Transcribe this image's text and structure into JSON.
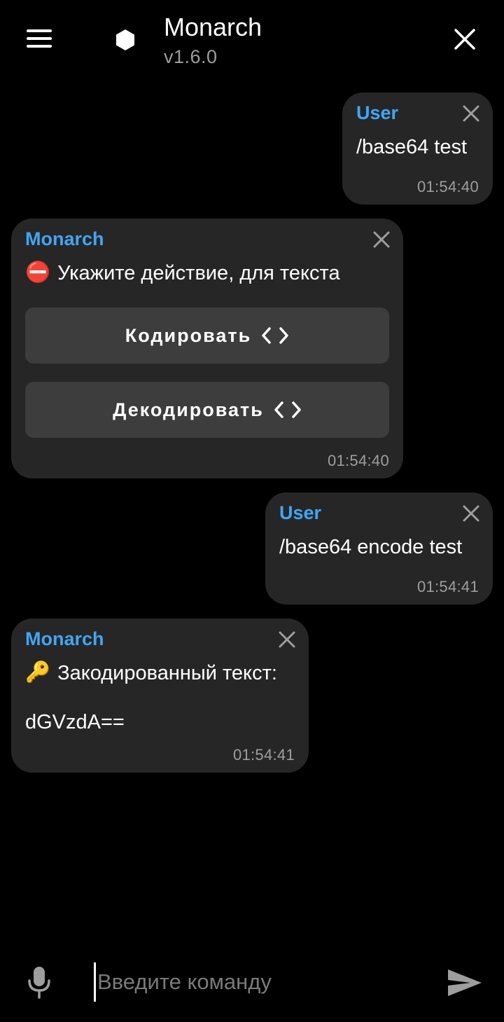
{
  "header": {
    "title": "Monarch",
    "version": "v1.6.0",
    "menu_icon": "hamburger-menu-icon",
    "logo_icon": "hexagon-icon",
    "close_icon": "close-icon"
  },
  "messages": [
    {
      "sender": "User",
      "text": "/base64 test",
      "time": "01:54:40"
    },
    {
      "sender": "Monarch",
      "emoji": "⛔",
      "text": "Укажите действие, для текста",
      "buttons": [
        {
          "label": "Кодировать",
          "icon": "code-icon"
        },
        {
          "label": "Декодировать",
          "icon": "code-icon"
        }
      ],
      "time": "01:54:40"
    },
    {
      "sender": "User",
      "text": "/base64 encode test",
      "time": "01:54:41"
    },
    {
      "sender": "Monarch",
      "emoji": "🔑",
      "text": "Закодированный текст:",
      "result": "dGVzdA==",
      "time": "01:54:41"
    }
  ],
  "input": {
    "placeholder": "Введите команду",
    "value": "",
    "mic_icon": "microphone-icon",
    "send_icon": "send-icon"
  },
  "colors": {
    "background": "#000000",
    "bubble": "#262626",
    "button": "#3d3d3d",
    "accent": "#42a5f5",
    "muted": "#9e9e9e"
  }
}
